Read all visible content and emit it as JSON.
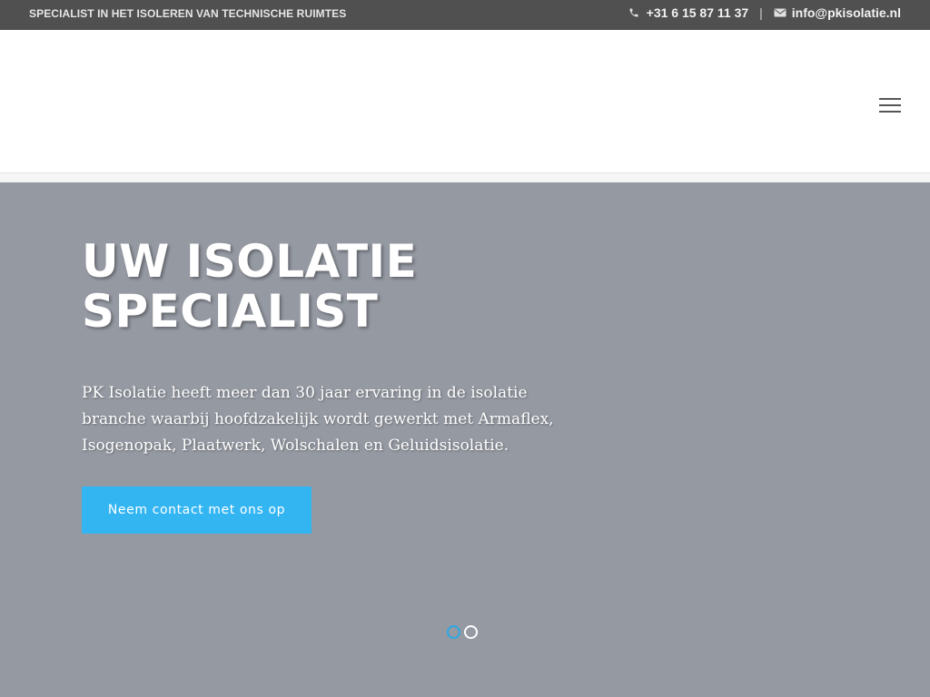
{
  "topbar": {
    "tagline": "SPECIALIST IN HET ISOLEREN VAN TECHNISCHE RUIMTES",
    "phone": "+31 6 15 87 11 37",
    "separator": "|",
    "email": "info@pkisolatie.nl",
    "phone_icon": "phone-icon",
    "email_icon": "envelope-icon"
  },
  "header": {
    "menu_icon": "hamburger-menu-icon"
  },
  "hero": {
    "title_line1": "UW ISOLATIE",
    "title_line2": "SPECIALIST",
    "text": "PK Isolatie heeft meer dan 30 jaar ervaring in de isolatie branche waarbij hoofdzakelijk wordt gewerkt met Armaflex, Isogenopak, Plaatwerk, Wolschalen en Geluidsisolatie.",
    "cta_label": "Neem contact met ons op",
    "slides_total": 2,
    "active_slide": 1
  },
  "colors": {
    "topbar_bg": "#505050",
    "hero_bg": "#9599a2",
    "accent": "#33b5f2"
  }
}
